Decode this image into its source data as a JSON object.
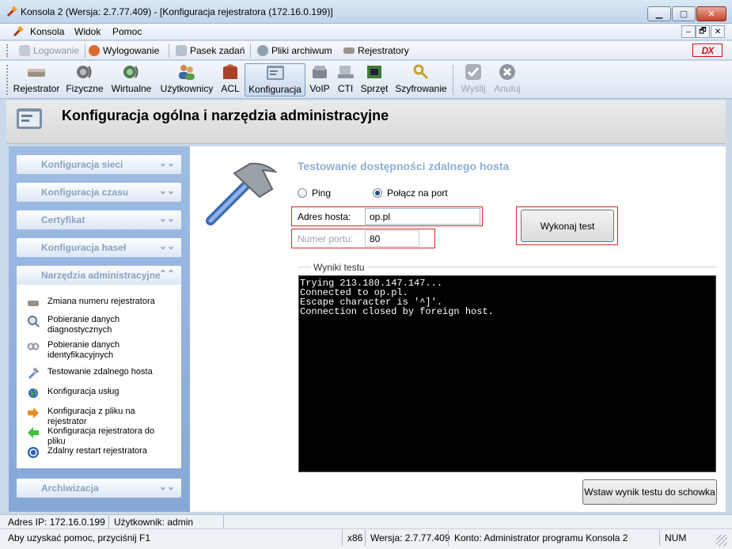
{
  "window": {
    "title": "Konsola 2 (Wersja:  2.7.77.409) - [Konfiguracja rejestratora (172.16.0.199)]",
    "mdi_buttons": [
      "–",
      "🗗",
      "✕"
    ]
  },
  "menu": [
    "Konsola",
    "Widok",
    "Pomoc"
  ],
  "toolbar_top": {
    "login": "Logowanie",
    "logout": "Wylogowanie",
    "taskbar": "Pasek zadań",
    "archive": "Pliki archiwum",
    "recorders": "Rejestratory",
    "logo": "DX"
  },
  "toolbar_main": [
    {
      "label": "Rejestrator",
      "icon": "recorder-icon"
    },
    {
      "label": "Fizyczne",
      "icon": "physical-icon"
    },
    {
      "label": "Wirtualne",
      "icon": "virtual-icon"
    },
    {
      "label": "Użytkownicy",
      "icon": "users-icon"
    },
    {
      "label": "ACL",
      "icon": "acl-icon"
    },
    {
      "label": "Konfiguracja",
      "icon": "config-icon"
    },
    {
      "label": "VoIP",
      "icon": "voip-icon"
    },
    {
      "label": "CTI",
      "icon": "cti-icon"
    },
    {
      "label": "Sprzęt",
      "icon": "hardware-icon"
    },
    {
      "label": "Szyfrowanie",
      "icon": "encryption-icon"
    },
    {
      "label": "Wyślij",
      "icon": "send-icon"
    },
    {
      "label": "Anuluj",
      "icon": "cancel-icon"
    }
  ],
  "header": {
    "title": "Konfiguracja ogólna i narzędzia administracyjne"
  },
  "sidebar": {
    "sections": [
      "Konfiguracja sieci",
      "Konfiguracja czasu",
      "Certyfikat",
      "Konfiguracja haseł",
      "Narzędzia administracyjne",
      "Archiwizacja"
    ],
    "tools": [
      "Zmiana numeru rejestratora",
      "Pobieranie danych diagnostycznych",
      "Pobieranie danych identyfikacyjnych",
      "Testowanie zdalnego hosta",
      "Konfiguracja usług",
      "Konfiguracja z pliku na rejestrator",
      "Konfiguracja rejestratora do pliku",
      "Zdalny restart rejestratora"
    ]
  },
  "main": {
    "title": "Testowanie dostępności zdalnego hosta",
    "radio_ping": "Ping",
    "radio_port": "Połącz na port",
    "selected_mode": "port",
    "host_label": "Adres hosta:",
    "host_value": "op.pl",
    "port_label": "Numer portu:",
    "port_value": "80",
    "test_button": "Wykonaj test",
    "results_label": "Wyniki testu",
    "results_output": "Trying 213.180.147.147...\nConnected to op.pl.\nEscape character is '^]'.\nConnection closed by foreign host.",
    "copy_button": "Wstaw wynik testu do schowka"
  },
  "status": {
    "ip": "Adres IP: 172.16.0.199",
    "user": "Użytkownik: admin",
    "help": "Aby uzyskać pomoc, przyciśnij F1",
    "arch": "x86",
    "version": "Wersja: 2.7.77.409",
    "account": "Konto: Administrator programu Konsola 2",
    "num": "NUM"
  },
  "colors": {
    "accent": "#8eaed4",
    "highlight_border": "#d62828",
    "sidebar": "#9fbde4"
  }
}
